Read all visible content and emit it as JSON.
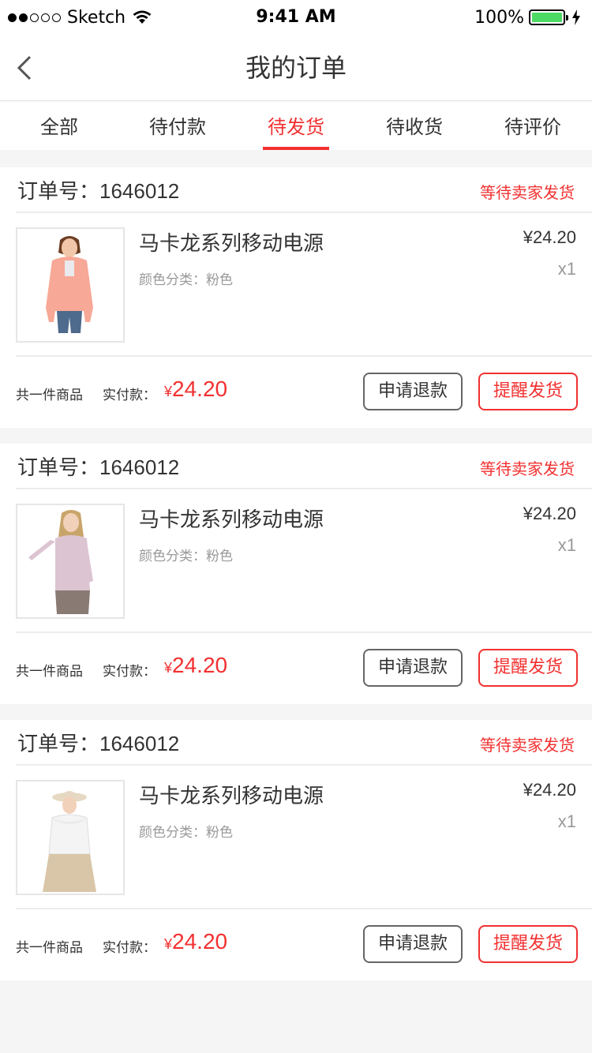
{
  "status_bar": {
    "carrier": "Sketch",
    "time": "9:41 AM",
    "battery": "100%"
  },
  "nav": {
    "title": "我的订单"
  },
  "tabs": [
    {
      "label": "全部"
    },
    {
      "label": "待付款"
    },
    {
      "label": "待发货",
      "active": true
    },
    {
      "label": "待收货"
    },
    {
      "label": "待评价"
    }
  ],
  "colors": {
    "accent": "#f23030",
    "battery": "#4cd964"
  },
  "orders": [
    {
      "order_label": "订单号：",
      "order_no": "1646012",
      "status": "等待卖家发货",
      "item": {
        "name": "马卡龙系列移动电源",
        "spec": "颜色分类：粉色",
        "price": "¥24.20",
        "qty": "x1",
        "image": "pink-hoodie-model"
      },
      "total_count": "共一件商品",
      "paid_label": "实付款：",
      "currency": "¥",
      "paid_amount": "24.20",
      "refund_label": "申请退款",
      "remind_label": "提醒发货"
    },
    {
      "order_label": "订单号：",
      "order_no": "1646012",
      "status": "等待卖家发货",
      "item": {
        "name": "马卡龙系列移动电源",
        "spec": "颜色分类：粉色",
        "price": "¥24.20",
        "qty": "x1",
        "image": "lilac-sweater-model"
      },
      "total_count": "共一件商品",
      "paid_label": "实付款：",
      "currency": "¥",
      "paid_amount": "24.20",
      "refund_label": "申请退款",
      "remind_label": "提醒发货"
    },
    {
      "order_label": "订单号：",
      "order_no": "1646012",
      "status": "等待卖家发货",
      "item": {
        "name": "马卡龙系列移动电源",
        "spec": "颜色分类：粉色",
        "price": "¥24.20",
        "qty": "x1",
        "image": "white-blouse-model"
      },
      "total_count": "共一件商品",
      "paid_label": "实付款：",
      "currency": "¥",
      "paid_amount": "24.20",
      "refund_label": "申请退款",
      "remind_label": "提醒发货"
    }
  ]
}
